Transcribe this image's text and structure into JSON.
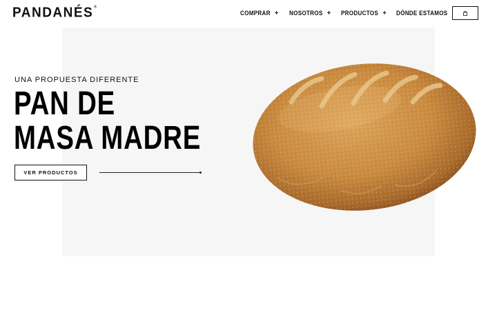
{
  "brand": {
    "name": "PANDANÉS",
    "trademark": "®"
  },
  "nav": {
    "items": [
      {
        "label": "COMPRAR",
        "has_submenu": true,
        "plus": "+"
      },
      {
        "label": "NOSOTROS",
        "has_submenu": true,
        "plus": "+"
      },
      {
        "label": "PRODUCTOS",
        "has_submenu": true,
        "plus": "+"
      },
      {
        "label": "DÓNDE ESTAMOS",
        "has_submenu": false,
        "plus": ""
      }
    ],
    "cart_icon": "shopping-bag-icon"
  },
  "hero": {
    "eyebrow": "UNA PROPUESTA DIFERENTE",
    "title_line_1": "PAN DE",
    "title_line_2": "MASA MADRE",
    "cta_label": "VER PRODUCTOS",
    "image_subject": "sourdough-bread-loaf"
  },
  "colors": {
    "text": "#111111",
    "hero_background": "#f6f6f6",
    "bread_crust": "#c98a3e"
  }
}
